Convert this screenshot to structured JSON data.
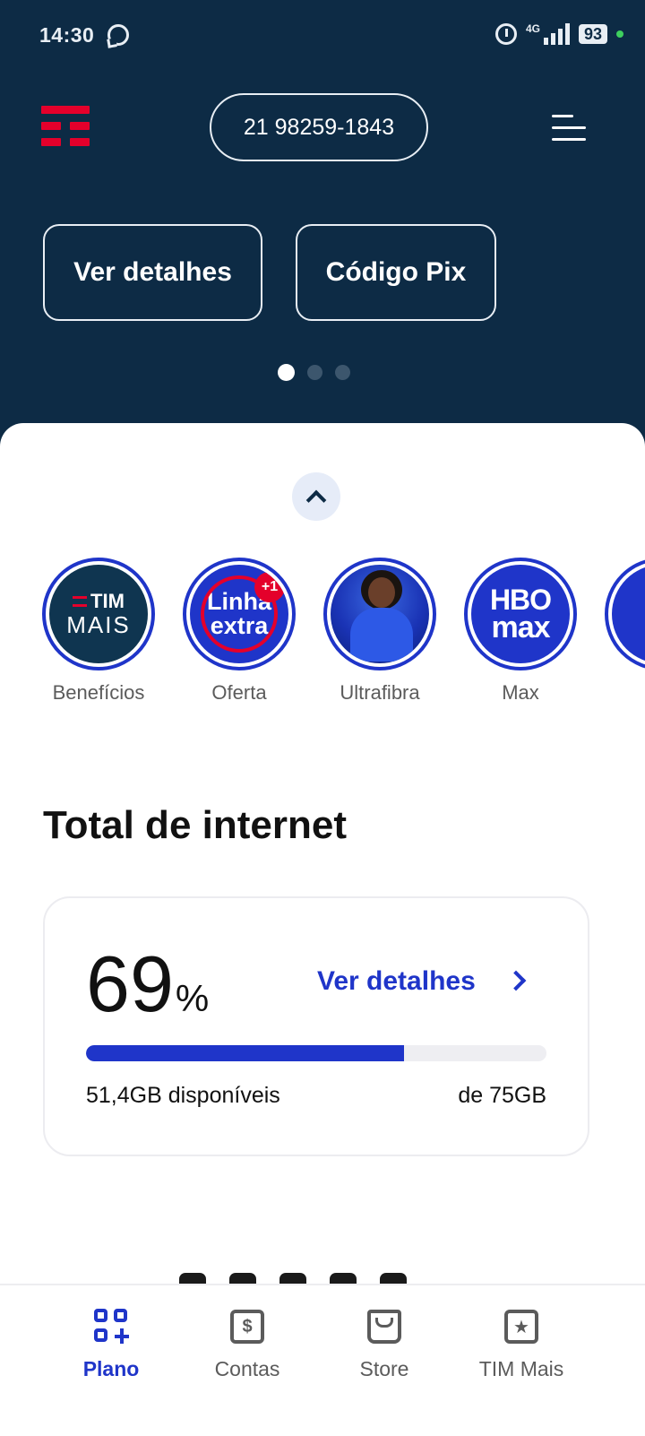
{
  "status_bar": {
    "time": "14:30",
    "network": "4G",
    "battery": "93"
  },
  "header": {
    "phone_number": "21 98259-1843"
  },
  "quick_actions": [
    "Ver detalhes",
    "Código Pix"
  ],
  "carousel": {
    "pages": 3,
    "active_page": 1
  },
  "stories": [
    {
      "label": "Benefícios",
      "art_line1": "TIM",
      "art_line2": "MAIS"
    },
    {
      "label": "Oferta",
      "art_line1": "Linha",
      "art_line2": "extra",
      "badge": "+1"
    },
    {
      "label": "Ultrafibra"
    },
    {
      "label": "Max",
      "art_line1": "HBO",
      "art_line2": "max"
    }
  ],
  "internet": {
    "title": "Total de internet",
    "percent": "69",
    "percent_sign": "%",
    "percent_value": 0.69,
    "details_link": "Ver detalhes",
    "available": "51,4GB disponíveis",
    "total": "de 75GB"
  },
  "bottom_nav": [
    {
      "label": "Plano",
      "icon": "plan-grid-icon",
      "active": true
    },
    {
      "label": "Contas",
      "icon": "bill-dollar-icon",
      "active": false
    },
    {
      "label": "Store",
      "icon": "shopping-bag-icon",
      "active": false
    },
    {
      "label": "TIM Mais",
      "icon": "star-badge-icon",
      "active": false
    }
  ],
  "colors": {
    "header_bg": "#0d2b45",
    "accent": "#1f35c9",
    "brand_red": "#e4002b"
  }
}
